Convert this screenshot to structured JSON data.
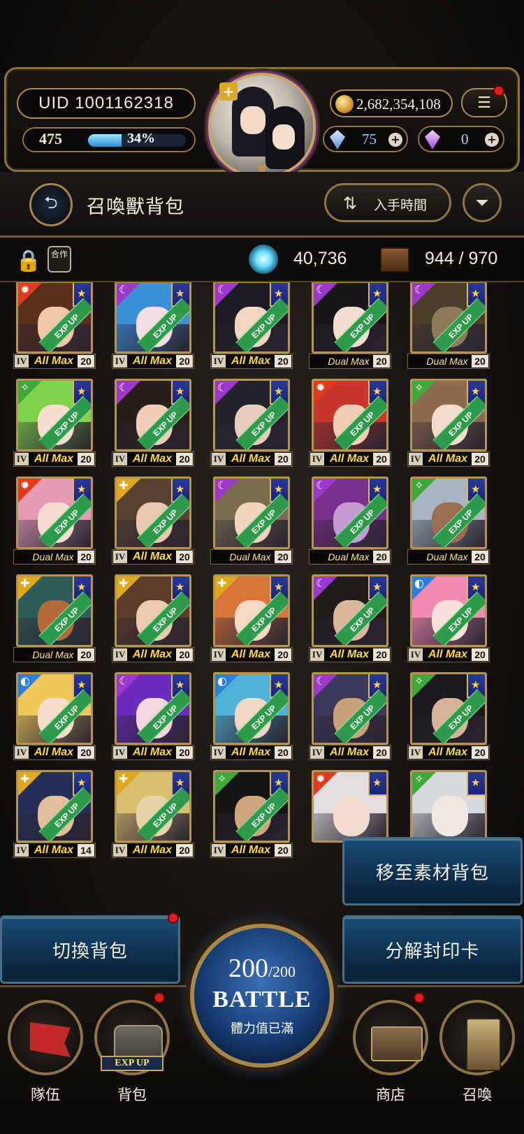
{
  "hud": {
    "uid": "UID 1001162318",
    "level": "475",
    "exp_percent_text": "34%",
    "exp_fraction": 0.34,
    "gold": "2,682,354,108",
    "gem_blue": "75",
    "gem_purple": "0"
  },
  "header": {
    "title": "召喚獸背包",
    "sort_label": "入手時間"
  },
  "strip": {
    "craft_label": "合作",
    "orb_count": "40,736",
    "capacity": "944 / 970"
  },
  "cards": [
    {
      "elem": "fire",
      "status": "All Max",
      "dual": false,
      "level": "20",
      "hair": "#5a2f1c",
      "face": "#efc6a6"
    },
    {
      "elem": "dark",
      "status": "All Max",
      "dual": false,
      "level": "20",
      "hair": "#3c8fd9",
      "face": "#f5dde4"
    },
    {
      "elem": "dark",
      "status": "All Max",
      "dual": false,
      "level": "20",
      "hair": "#1d1c24",
      "face": "#f1d4c2"
    },
    {
      "elem": "dark",
      "status": "Dual Max",
      "dual": true,
      "level": "20",
      "hair": "#161518",
      "face": "#f3ddd0"
    },
    {
      "elem": "dark",
      "status": "Dual Max",
      "dual": true,
      "level": "20",
      "hair": "#4b3f2a",
      "face": "#8d7a5a"
    },
    {
      "elem": "wind",
      "status": "All Max",
      "dual": false,
      "level": "20",
      "hair": "#7ed34a",
      "face": "#f6dccd"
    },
    {
      "elem": "dark",
      "status": "All Max",
      "dual": false,
      "level": "20",
      "hair": "#2b1d18",
      "face": "#efcdb8"
    },
    {
      "elem": "dark",
      "status": "All Max",
      "dual": false,
      "level": "20",
      "hair": "#24232c",
      "face": "#e7cdbb"
    },
    {
      "elem": "fire",
      "status": "All Max",
      "dual": false,
      "level": "20",
      "hair": "#c8362d",
      "face": "#f1cdb5"
    },
    {
      "elem": "wind",
      "status": "All Max",
      "dual": false,
      "level": "20",
      "hair": "#8b6a4e",
      "face": "#f4dccd"
    },
    {
      "elem": "fire",
      "status": "Dual Max",
      "dual": true,
      "level": "20",
      "hair": "#e59ab6",
      "face": "#f6dcd0"
    },
    {
      "elem": "light",
      "status": "All Max",
      "dual": false,
      "level": "20",
      "hair": "#5a4230",
      "face": "#e8c9b0"
    },
    {
      "elem": "dark",
      "status": "Dual Max",
      "dual": true,
      "level": "20",
      "hair": "#7c6d52",
      "face": "#f0d4bd"
    },
    {
      "elem": "dark",
      "status": "Dual Max",
      "dual": true,
      "level": "20",
      "hair": "#7b2f8e",
      "face": "#c49ad4"
    },
    {
      "elem": "wind",
      "status": "Dual Max",
      "dual": true,
      "level": "20",
      "hair": "#a8b6c2",
      "face": "#9a6e4f"
    },
    {
      "elem": "light",
      "status": "Dual Max",
      "dual": true,
      "level": "20",
      "hair": "#2f5d5a",
      "face": "#b46b3a"
    },
    {
      "elem": "light",
      "status": "All Max",
      "dual": false,
      "level": "20",
      "hair": "#5c3c2a",
      "face": "#eacab1"
    },
    {
      "elem": "light",
      "status": "All Max",
      "dual": false,
      "level": "20",
      "hair": "#d9733a",
      "face": "#f5d9c5"
    },
    {
      "elem": "dark",
      "status": "All Max",
      "dual": false,
      "level": "20",
      "hair": "#201c1a",
      "face": "#d9b79c"
    },
    {
      "elem": "water",
      "status": "All Max",
      "dual": false,
      "level": "20",
      "hair": "#f28bb2",
      "face": "#f7e0da"
    },
    {
      "elem": "water",
      "status": "All Max",
      "dual": false,
      "level": "20",
      "hair": "#f0c85a",
      "face": "#f6dccb"
    },
    {
      "elem": "dark",
      "status": "All Max",
      "dual": false,
      "level": "20",
      "hair": "#6b2bbd",
      "face": "#f2d6df"
    },
    {
      "elem": "water",
      "status": "All Max",
      "dual": false,
      "level": "20",
      "hair": "#4fb2d8",
      "face": "#f1d6c6"
    },
    {
      "elem": "dark",
      "status": "All Max",
      "dual": false,
      "level": "20",
      "hair": "#3b3a5a",
      "face": "#c8a07a"
    },
    {
      "elem": "wind",
      "status": "All Max",
      "dual": false,
      "level": "20",
      "hair": "#1c1a1e",
      "face": "#d8b496"
    },
    {
      "elem": "light",
      "status": "All Max",
      "dual": false,
      "level": "14",
      "hair": "#25305a",
      "face": "#e3bf9c"
    },
    {
      "elem": "light",
      "status": "All Max",
      "dual": false,
      "level": "20",
      "hair": "#d9c070",
      "face": "#e8d2a8"
    },
    {
      "elem": "wind",
      "status": "All Max",
      "dual": false,
      "level": "20",
      "hair": "#151414",
      "face": "#cfa57f"
    },
    {
      "elem": "fire",
      "status": "",
      "dual": false,
      "level": "",
      "hair": "#e1dde0",
      "face": "#f1dbcf"
    },
    {
      "elem": "wind",
      "status": "",
      "dual": false,
      "level": "",
      "hair": "#d6d9dd",
      "face": "#efe7e2"
    }
  ],
  "actions": {
    "move_to_material": "移至素材背包",
    "switch_bag": "切換背包",
    "decompose": "分解封印卡"
  },
  "battle": {
    "stamina_current": "200",
    "stamina_max": "/200",
    "label": "BATTLE",
    "status": "體力值已滿"
  },
  "nav": {
    "team": "隊伍",
    "bag": "背包",
    "bag_banner": "EXP UP",
    "shop": "商店",
    "summon": "召喚"
  },
  "colors": {
    "fire": "#e23a1c",
    "dark": "#9b37c9",
    "wind": "#3fa83a",
    "light": "#e0a81a",
    "water": "#2a7fd8",
    "expup": "#2e9a4b",
    "allmax": "#ffd84a"
  }
}
